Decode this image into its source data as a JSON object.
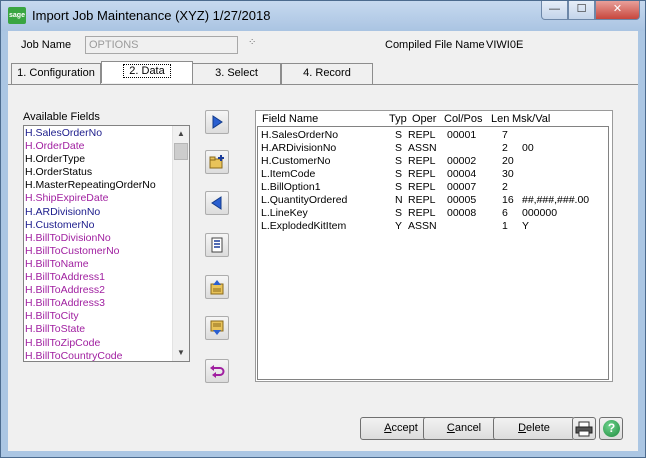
{
  "window": {
    "logo": "sage",
    "title": "Import Job Maintenance (XYZ) 1/27/2018",
    "minimize": "—",
    "maximize": "☐",
    "close": "✕"
  },
  "header": {
    "job_name_label": "Job Name",
    "job_name_value": "OPTIONS",
    "lookup_glyph": "⁘",
    "compiled_label": "Compiled File Name",
    "compiled_value": "VIWI0E"
  },
  "tabs": [
    {
      "label": "1. Configuration",
      "active": false
    },
    {
      "label": "2. Data",
      "active": true
    },
    {
      "label": "3. Select",
      "active": false
    },
    {
      "label": "4. Record",
      "active": false
    }
  ],
  "available_fields": {
    "title": "Available Fields",
    "items": [
      {
        "label": "H.SalesOrderNo",
        "color": "#1c1c8c"
      },
      {
        "label": "H.OrderDate",
        "color": "#a01fa0"
      },
      {
        "label": "H.OrderType",
        "color": "#000000"
      },
      {
        "label": "H.OrderStatus",
        "color": "#000000"
      },
      {
        "label": "H.MasterRepeatingOrderNo",
        "color": "#000000"
      },
      {
        "label": "H.ShipExpireDate",
        "color": "#a01fa0"
      },
      {
        "label": "H.ARDivisionNo",
        "color": "#1c1c8c"
      },
      {
        "label": "H.CustomerNo",
        "color": "#1c1c8c"
      },
      {
        "label": "H.BillToDivisionNo",
        "color": "#a01fa0"
      },
      {
        "label": "H.BillToCustomerNo",
        "color": "#a01fa0"
      },
      {
        "label": "H.BillToName",
        "color": "#a01fa0"
      },
      {
        "label": "H.BillToAddress1",
        "color": "#a01fa0"
      },
      {
        "label": "H.BillToAddress2",
        "color": "#a01fa0"
      },
      {
        "label": "H.BillToAddress3",
        "color": "#a01fa0"
      },
      {
        "label": "H.BillToCity",
        "color": "#a01fa0"
      },
      {
        "label": "H.BillToState",
        "color": "#a01fa0"
      },
      {
        "label": "H.BillToZipCode",
        "color": "#a01fa0"
      },
      {
        "label": "H.BillToCountryCode",
        "color": "#a01fa0"
      }
    ]
  },
  "import_fields": {
    "columns": {
      "field_name": "Field Name",
      "typ": "Typ",
      "oper": "Oper",
      "colpos": "Col/Pos",
      "len": "Len",
      "mskval": "Msk/Val"
    },
    "rows": [
      {
        "field": "H.SalesOrderNo",
        "typ": "S",
        "oper": "REPL",
        "colpos": "00001",
        "len": "7",
        "msk": ""
      },
      {
        "field": "H.ARDivisionNo",
        "typ": "S",
        "oper": "ASSN",
        "colpos": "",
        "len": "2",
        "msk": "00"
      },
      {
        "field": "H.CustomerNo",
        "typ": "S",
        "oper": "REPL",
        "colpos": "00002",
        "len": "20",
        "msk": ""
      },
      {
        "field": "L.ItemCode",
        "typ": "S",
        "oper": "REPL",
        "colpos": "00004",
        "len": "30",
        "msk": ""
      },
      {
        "field": "L.BillOption1",
        "typ": "S",
        "oper": "REPL",
        "colpos": "00007",
        "len": "2",
        "msk": ""
      },
      {
        "field": "L.QuantityOrdered",
        "typ": "N",
        "oper": "REPL",
        "colpos": "00005",
        "len": "16",
        "msk": "##,###,###.00"
      },
      {
        "field": "L.LineKey",
        "typ": "S",
        "oper": "REPL",
        "colpos": "00008",
        "len": "6",
        "msk": "000000"
      },
      {
        "field": "L.ExplodedKitItem",
        "typ": "Y",
        "oper": "ASSN",
        "colpos": "",
        "len": "1",
        "msk": "Y"
      }
    ]
  },
  "buttons": {
    "accept": {
      "hotkey": "A",
      "rest": "ccept"
    },
    "cancel": {
      "hotkey": "C",
      "rest": "ancel"
    },
    "delete": {
      "hotkey": "D",
      "rest": "elete"
    },
    "help": "?"
  },
  "colors": {
    "window_frame": "#abc6e3",
    "client_bg": "#f0f0f0",
    "arrow_blue": "#2a5fd0"
  }
}
